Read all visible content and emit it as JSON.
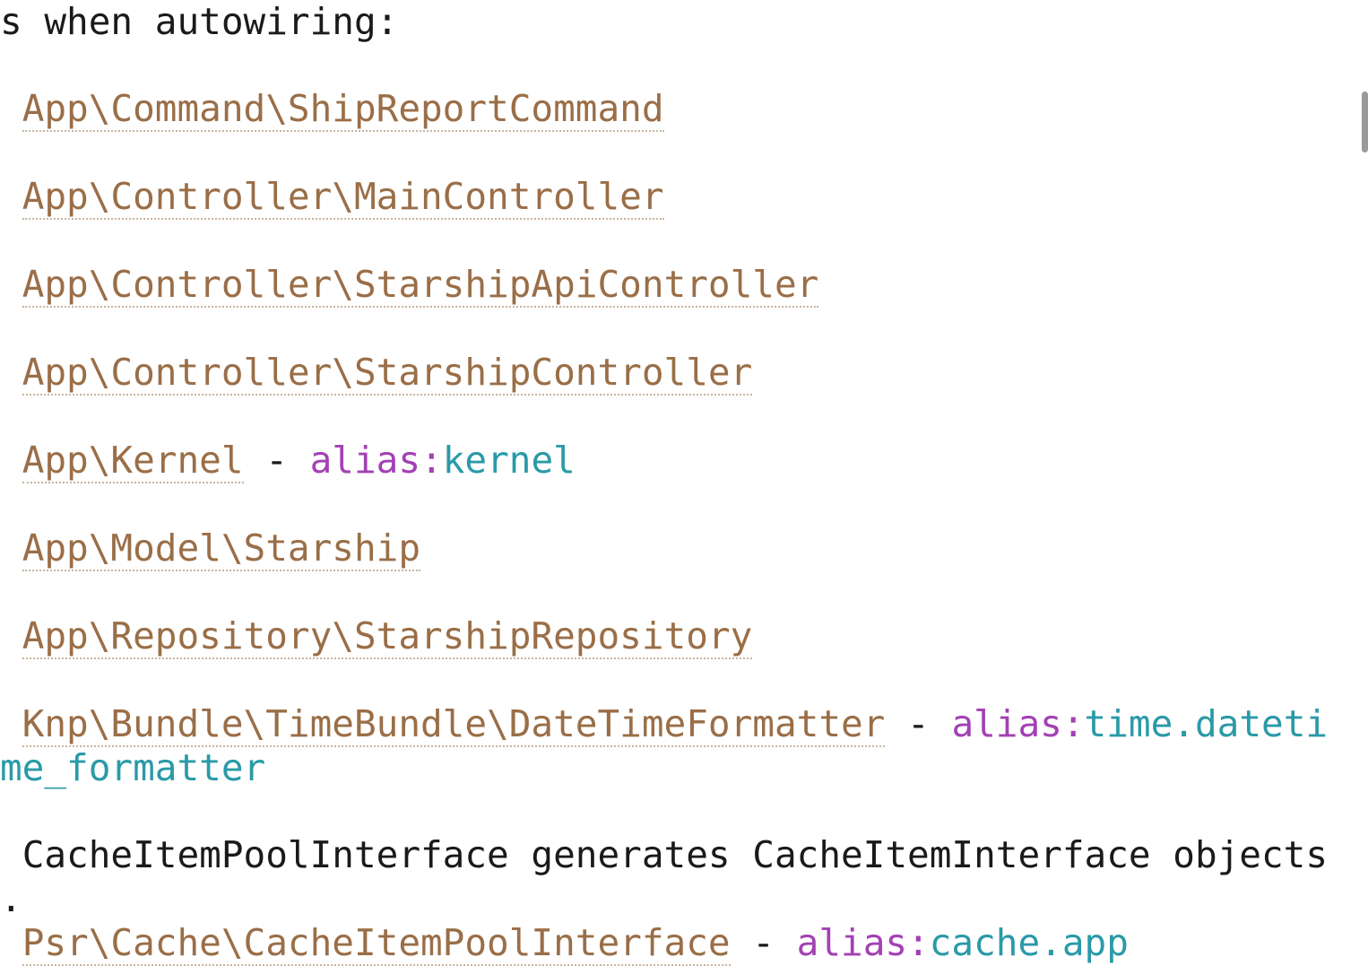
{
  "output": {
    "header_text": "s when autowiring:",
    "services": [
      {
        "class": "App\\Command\\ShipReportCommand"
      },
      {
        "class": "App\\Controller\\MainController"
      },
      {
        "class": "App\\Controller\\StarshipApiController"
      },
      {
        "class": "App\\Controller\\StarshipController"
      },
      {
        "class": "App\\Kernel",
        "separator": " - ",
        "alias_label": "alias:",
        "alias_value": "kernel"
      },
      {
        "class": "App\\Model\\Starship"
      },
      {
        "class": "App\\Repository\\StarshipRepository"
      },
      {
        "class": "Knp\\Bundle\\TimeBundle\\DateTimeFormatter",
        "separator": " - ",
        "alias_label": "alias:",
        "alias_value_part1": "time.dateti",
        "alias_value_part2": "me_formatter"
      }
    ],
    "description": "CacheItemPoolInterface generates CacheItemInterface objects",
    "description_wrap": ".",
    "last_service": {
      "class": "Psr\\Cache\\CacheItemPoolInterface",
      "separator": " - ",
      "alias_label": "alias:",
      "alias_value": "cache.app"
    }
  }
}
